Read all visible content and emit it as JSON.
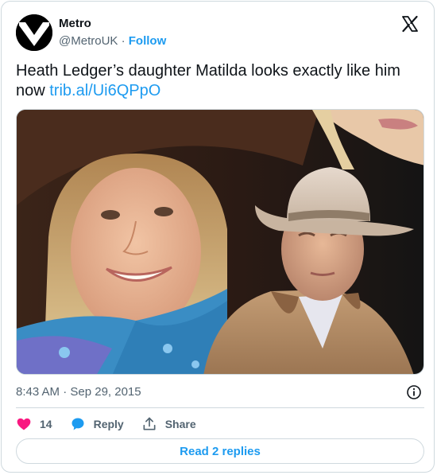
{
  "author": {
    "name": "Metro",
    "handle": "@MetroUK",
    "separator": "·",
    "follow_label": "Follow"
  },
  "tweet": {
    "text": "Heath Ledger’s daughter Matilda looks exactly like him now ",
    "link": "trib.al/Ui6QPpO",
    "timestamp": "8:43 AM · Sep 29, 2015"
  },
  "actions": {
    "like_count": "14",
    "reply_label": "Reply",
    "share_label": "Share"
  },
  "footer": {
    "read_replies_label": "Read 2 replies"
  },
  "colors": {
    "accent": "#1d9bf0",
    "like": "#f91880",
    "muted": "#536471",
    "border": "#cfd9de"
  },
  "icons": {
    "logo": "metro-logo-icon",
    "platform": "x-logo-icon",
    "info": "info-icon",
    "like": "heart-icon",
    "reply": "reply-bubble-icon",
    "share": "share-upload-icon"
  }
}
